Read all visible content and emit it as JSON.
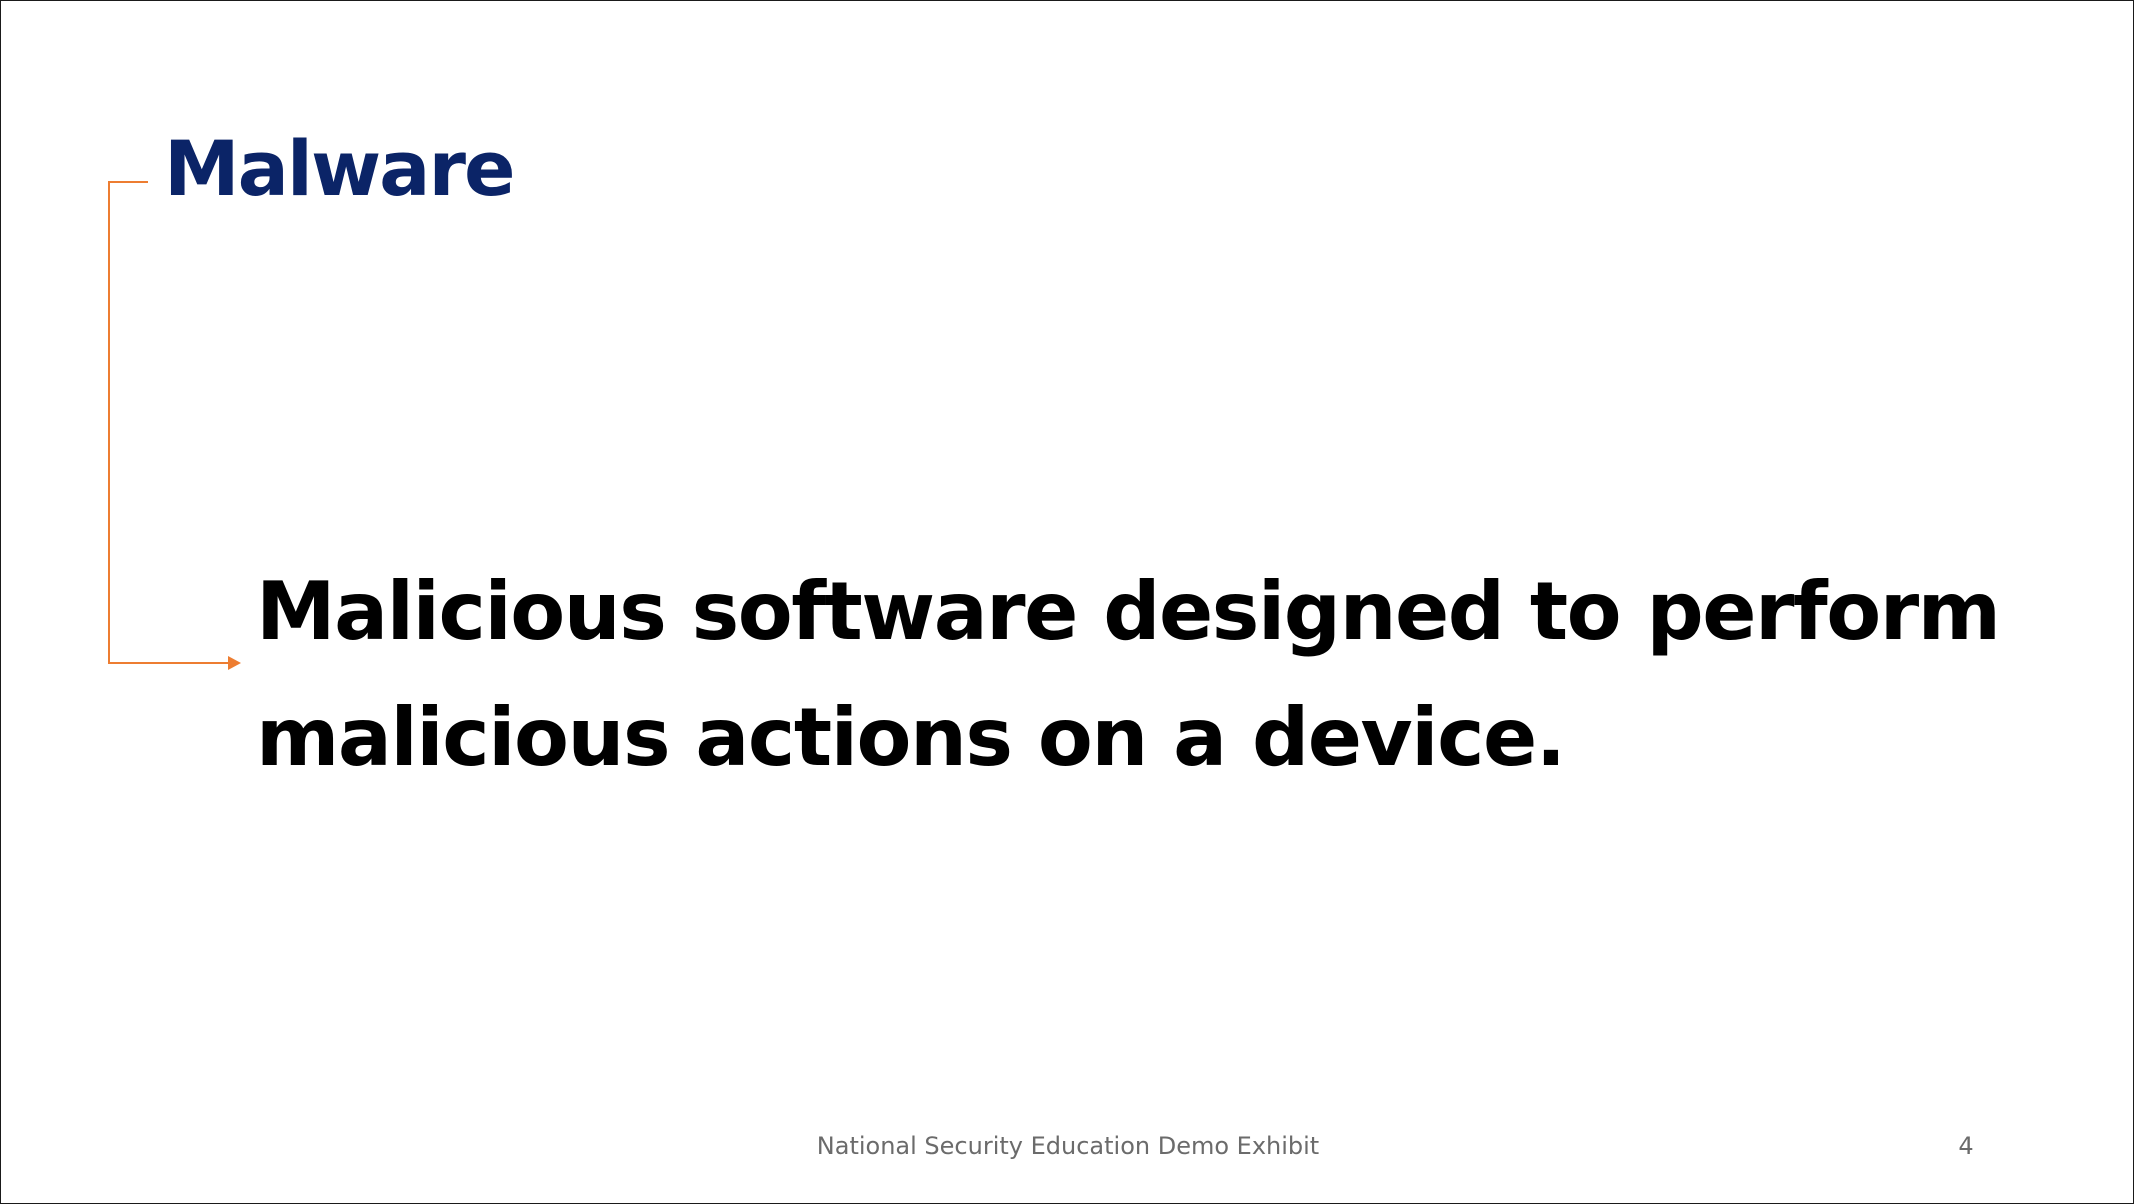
{
  "slide": {
    "title": "Malware",
    "definition": "Malicious software designed to perform malicious actions on a device.",
    "footer": "National Security Education Demo Exhibit",
    "page_number": "4"
  },
  "colors": {
    "title": "#0b2467",
    "body_text": "#000000",
    "connector": "#ed7d31",
    "footer_text": "#6b6b6b",
    "border": "#1a1a1a"
  },
  "icons": {
    "connector_arrow": "elbow-arrow-right"
  }
}
